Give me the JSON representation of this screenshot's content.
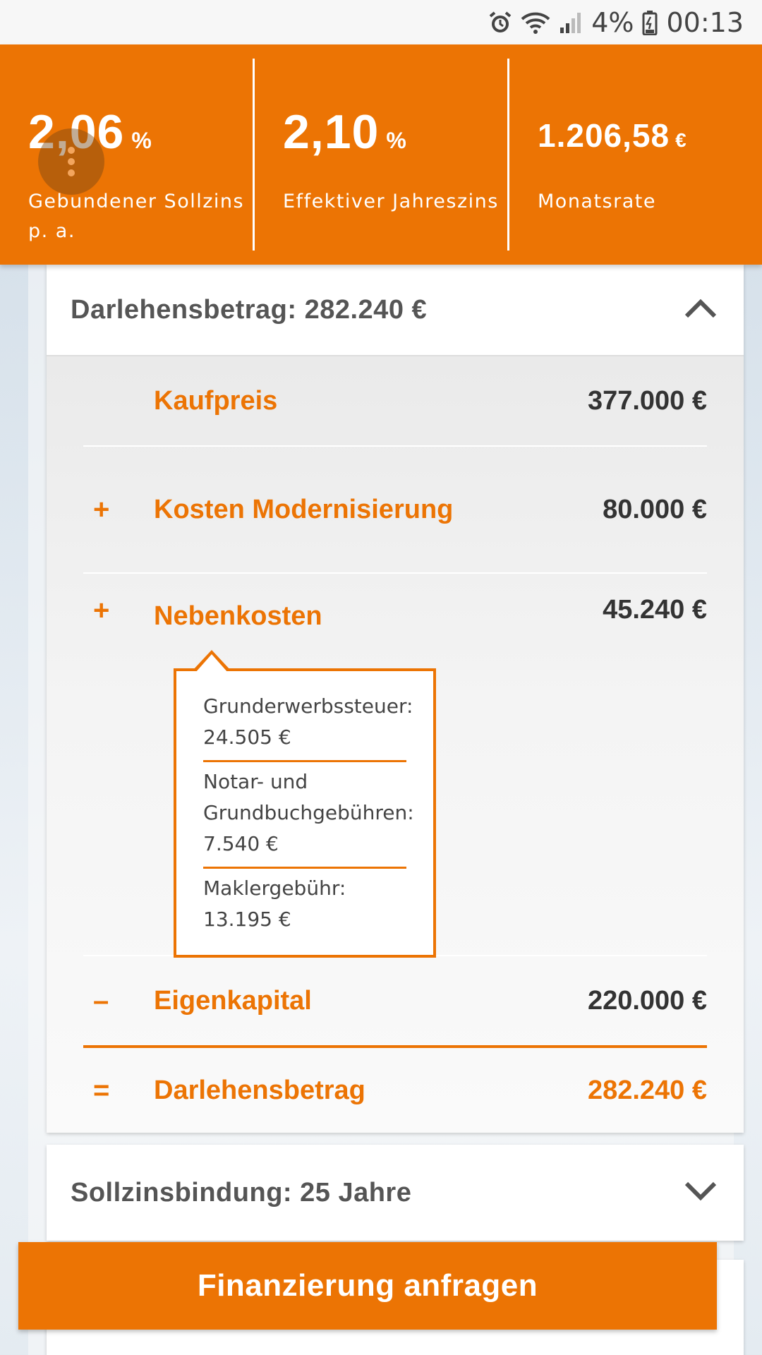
{
  "status_bar": {
    "battery": "4%",
    "time": "00:13",
    "icons": [
      "alarm-icon",
      "wifi-icon",
      "signal-icon",
      "battery-icon"
    ]
  },
  "rates": [
    {
      "value": "2,06",
      "unit": "%",
      "label": "Gebundener Sollzins p. a."
    },
    {
      "value": "2,10",
      "unit": "%",
      "label": "Effektiver Jahreszins"
    },
    {
      "value": "1.206,58",
      "unit": "€",
      "label": "Monatsrate"
    }
  ],
  "loan_card": {
    "title": "Darlehensbetrag: 282.240 €",
    "rows": [
      {
        "sign": "",
        "label": "Kaufpreis",
        "amount": "377.000 €"
      },
      {
        "sign": "+",
        "label": "Kosten Modernisierung",
        "amount": "80.000 €"
      },
      {
        "sign": "+",
        "label": "Nebenkosten",
        "amount": "45.240 €"
      },
      {
        "sign": "–",
        "label": "Eigenkapital",
        "amount": "220.000 €"
      },
      {
        "sign": "=",
        "label": "Darlehensbetrag",
        "amount": "282.240 €"
      }
    ],
    "tooltip": [
      "Grunderwerbssteuer: 24.505 €",
      "Notar- und Grundbuchgebühren: 7.540 €",
      "Maklergebühr: 13.195 €"
    ]
  },
  "fixation_card": {
    "title": "Sollzinsbindung: 25 Jahre"
  },
  "cta": {
    "label": "Finanzierung anfragen"
  },
  "colors": {
    "accent": "#ec7404"
  }
}
